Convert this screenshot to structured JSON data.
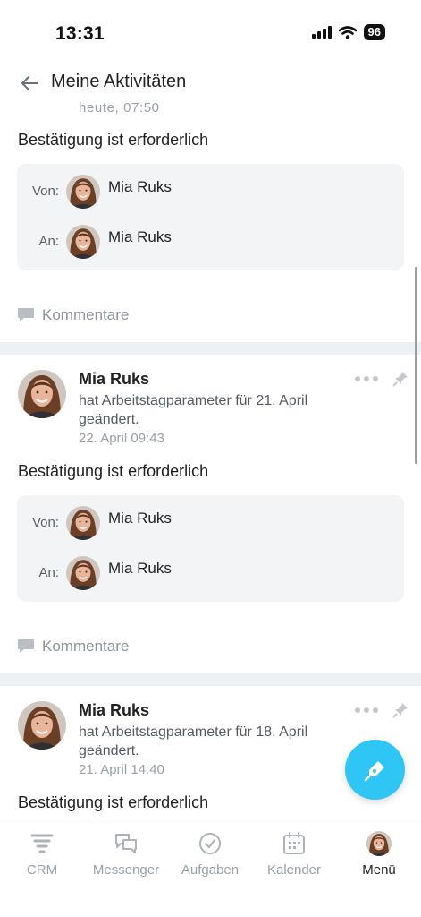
{
  "status_bar": {
    "time": "13:31",
    "battery": "96"
  },
  "header": {
    "title": "Meine Aktivitäten"
  },
  "partial_post": {
    "timestamp": "heute, 07:50",
    "confirmation": "Bestätigung ist erforderlich",
    "from_label": "Von:",
    "to_label": "An:",
    "from_name": "Mia Ruks",
    "to_name": "Mia Ruks",
    "comments_label": "Kommentare"
  },
  "posts": [
    {
      "author": "Mia Ruks",
      "text": "hat Arbeitstagparameter für 21. April geändert.",
      "time": "22. April 09:43",
      "confirmation": "Bestätigung ist erforderlich",
      "from_label": "Von:",
      "to_label": "An:",
      "from_name": "Mia Ruks",
      "to_name": "Mia Ruks",
      "comments_label": "Kommentare"
    },
    {
      "author": "Mia Ruks",
      "text": "hat Arbeitstagparameter für 18. April geändert.",
      "time": "21. April 14:40",
      "confirmation": "Bestätigung ist erforderlich"
    }
  ],
  "bottom_nav": {
    "items": [
      {
        "label": "CRM",
        "icon": "crm-funnel-icon"
      },
      {
        "label": "Messenger",
        "icon": "messenger-icon"
      },
      {
        "label": "Aufgaben",
        "icon": "tasks-check-icon"
      },
      {
        "label": "Kalender",
        "icon": "calendar-icon"
      },
      {
        "label": "Menü",
        "icon": "avatar"
      }
    ],
    "active_index": 4
  },
  "colors": {
    "accent": "#2fc6f6",
    "box_bg": "#f3f4f6",
    "divider": "#eef1f4",
    "muted_text": "#9aa0a6"
  }
}
